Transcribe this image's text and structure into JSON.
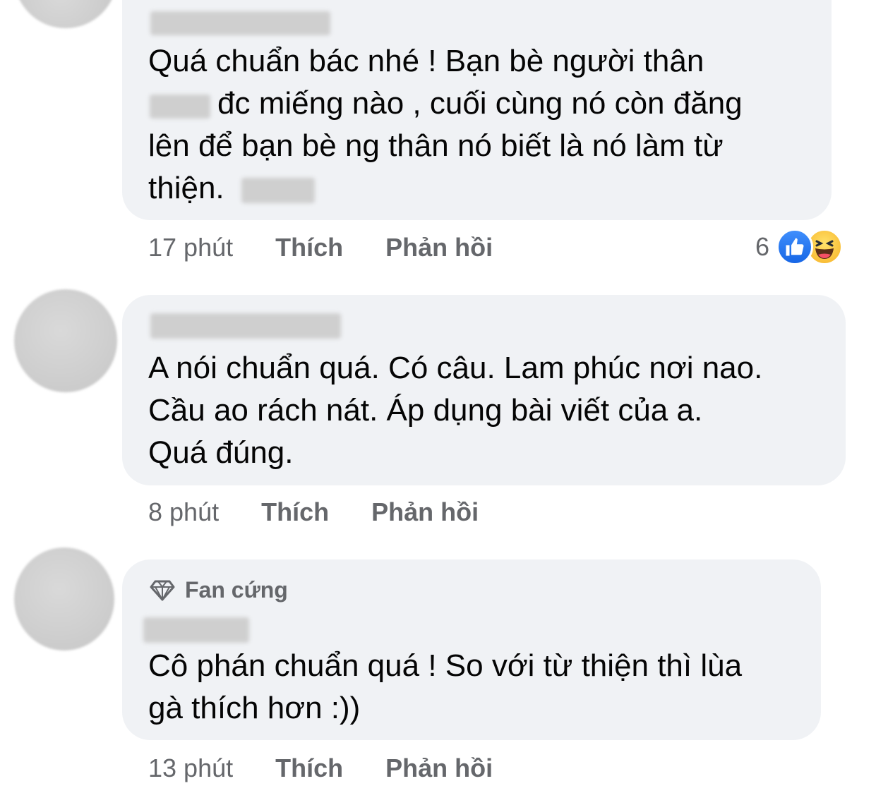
{
  "comments": [
    {
      "text": "Quá chuẩn bác nhé ! Bạn bè người thân\nđc miếng nào , cuối cùng nó còn đăng\nlên để bạn bè ng thân nó biết là nó làm từ\nthiện.",
      "time": "17 phút",
      "like_label": "Thích",
      "reply_label": "Phản hồi",
      "reaction_count": "6",
      "reactions": [
        "like-icon",
        "haha-icon"
      ]
    },
    {
      "text": "A nói chuẩn quá. Có câu. Lam phúc nơi nao.\nCầu ao rách nát. Áp dụng bài viết của a.\nQuá đúng.",
      "time": "8 phút",
      "like_label": "Thích",
      "reply_label": "Phản hồi"
    },
    {
      "badge": "Fan cứng",
      "badge_icon": "diamond-icon",
      "text": "Cô phán chuẩn quá ! So với từ thiện thì lùa\ngà thích hơn :))",
      "time": "13 phút",
      "like_label": "Thích",
      "reply_label": "Phản hồi"
    }
  ],
  "colors": {
    "bubble": "#f0f2f5",
    "meta": "#65676b",
    "like_blue": "#1877f2",
    "haha_yellow": "#f7b125"
  }
}
